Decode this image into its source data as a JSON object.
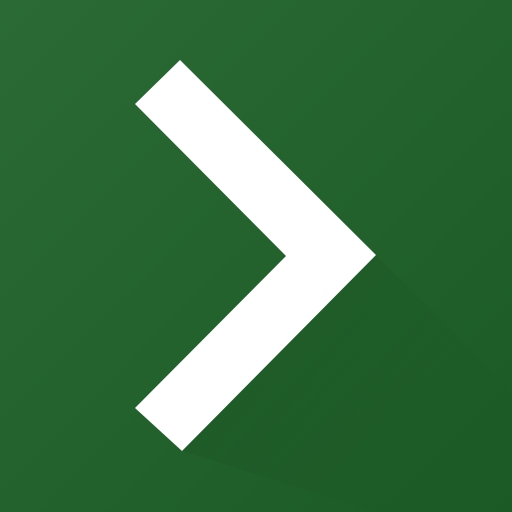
{
  "icon": {
    "name": "chevron-right-icon",
    "colors": {
      "background_top_left": "#2b6a35",
      "background_bottom_right": "#1b5a25",
      "chevron": "#ffffff",
      "shadow": "#184f21"
    }
  }
}
